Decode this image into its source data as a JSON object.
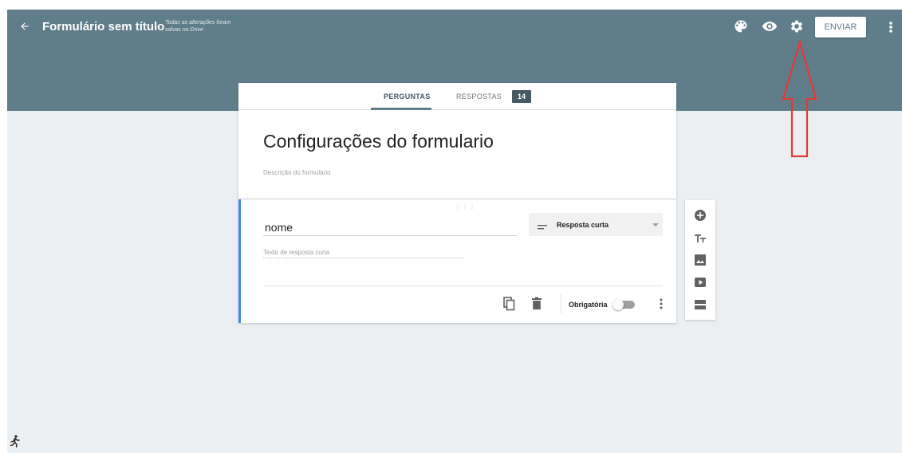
{
  "header": {
    "back_icon": "arrow-left-icon",
    "title": "Formulário sem título",
    "save_status_line1": "Todas as alterações foram",
    "save_status_line2": "salvas no Drive",
    "icons": [
      "palette-icon",
      "eye-icon",
      "gear-icon",
      "more-vert-icon"
    ],
    "send_label": "ENVIAR"
  },
  "tabs": {
    "questions_label": "PERGUNTAS",
    "responses_label": "RESPOSTAS",
    "responses_count": "14"
  },
  "form": {
    "title": "Configurações do formulario",
    "description_placeholder": "Descrição do formulário"
  },
  "question": {
    "title": "nome",
    "type_label": "Resposta curta",
    "type_icon": "short-text-icon",
    "answer_placeholder": "Texto de resposta curta",
    "required_label": "Obrigatória",
    "required_on": false,
    "footer_icons": [
      "copy-icon",
      "trash-icon",
      "more-vert-icon"
    ]
  },
  "side_toolbar": {
    "icons": [
      "add-question-icon",
      "title-text-icon",
      "image-icon",
      "video-icon",
      "section-icon"
    ]
  },
  "colors": {
    "header": "#607d8b",
    "background": "#eceff1",
    "accent": "#4285f4",
    "annotation_arrow": "#e53935"
  }
}
